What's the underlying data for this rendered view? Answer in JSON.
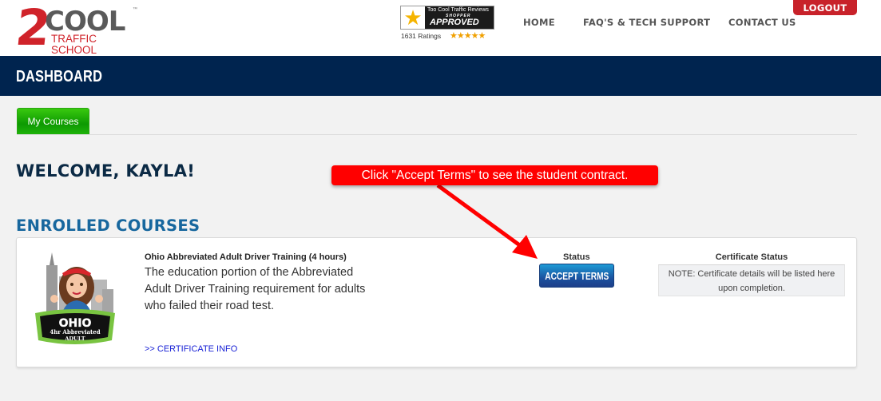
{
  "header": {
    "logo": {
      "main": "2",
      "word": "COOL",
      "tm": "™",
      "subtitle": "TRAFFIC SCHOOL"
    },
    "badge": {
      "line1": "Too Cool Traffic Reviews",
      "line2": "SHOPPER",
      "line3": "APPROVED",
      "ratings": "1631 Ratings",
      "stars": "★★★★★"
    },
    "nav": {
      "home": "HOME",
      "faq": "FAQ'S & TECH SUPPORT",
      "contact": "CONTACT US"
    },
    "logout_label": "LOGOUT"
  },
  "dashboard": {
    "title": "DASHBOARD"
  },
  "tabs": [
    {
      "label": "My Courses",
      "active": true
    }
  ],
  "welcome": "WELCOME, KAYLA!",
  "enrolled_heading": "ENROLLED COURSES",
  "course": {
    "badge_text": "OHIO",
    "badge_sub": "4hr Abbreviated",
    "badge_sub2": "ADULT",
    "name": "Ohio Abbreviated Adult Driver Training (4 hours)",
    "description": "The education portion of the Abbreviated Adult Driver Training requirement for adults who failed their road test.",
    "cert_link": ">> CERTIFICATE INFO",
    "status_label": "Status",
    "status_button": "ACCEPT TERMS",
    "cert_status_label": "Certificate Status",
    "cert_note": "NOTE: Certificate details will be listed here upon completion."
  },
  "annotation": {
    "text": "Click \"Accept Terms\" to see the student contract.",
    "color": "#ff0000"
  },
  "colors": {
    "brand_red": "#d0232a",
    "navy": "#00244f",
    "heading_blue": "#17679e",
    "tab_green": "#0d9a02",
    "link_blue": "#1a23d6"
  }
}
